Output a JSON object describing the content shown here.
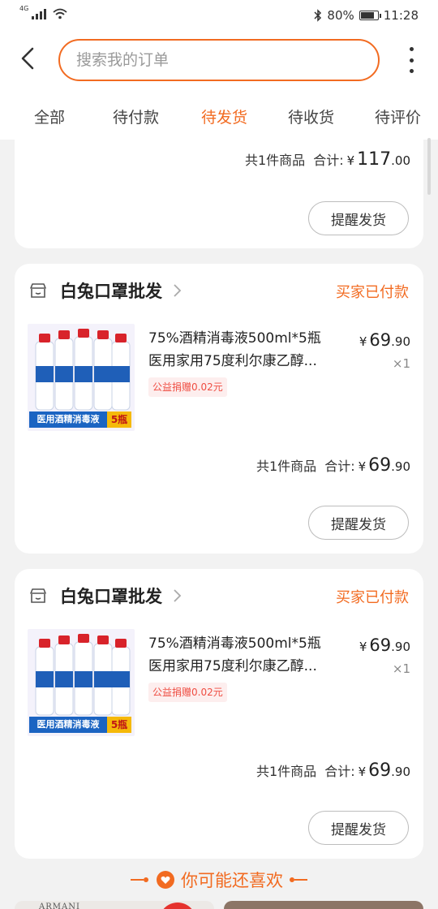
{
  "status_bar": {
    "network": "4G",
    "battery": "80%",
    "battery_level": 0.8,
    "time": "11:28"
  },
  "search": {
    "placeholder": "搜索我的订单"
  },
  "tabs": [
    {
      "label": "全部"
    },
    {
      "label": "待付款"
    },
    {
      "label": "待发货",
      "active": true
    },
    {
      "label": "待收货"
    },
    {
      "label": "待评价"
    }
  ],
  "orders": [
    {
      "total_count": "共1件商品",
      "total_label": "合计:",
      "currency": "¥",
      "total_int": "117",
      "total_dec": ".00",
      "action": "提醒发货"
    },
    {
      "shop": "白兔口罩批发",
      "status": "买家已付款",
      "product_line1": "75%酒精消毒液500ml*5瓶",
      "product_line2": "医用家用75度利尔康乙醇...",
      "charity": "公益捐赠0.02元",
      "currency": "¥",
      "price_int": "69",
      "price_dec": ".90",
      "qty": "×1",
      "thumb_strip": "医用酒精消毒液",
      "thumb_count": "5瓶",
      "total_count": "共1件商品",
      "total_label": "合计:",
      "total_int": "69",
      "total_dec": ".90",
      "action": "提醒发货"
    },
    {
      "shop": "白兔口罩批发",
      "status": "买家已付款",
      "product_line1": "75%酒精消毒液500ml*5瓶",
      "product_line2": "医用家用75度利尔康乙醇...",
      "charity": "公益捐赠0.02元",
      "currency": "¥",
      "price_int": "69",
      "price_dec": ".90",
      "qty": "×1",
      "thumb_strip": "医用酒精消毒液",
      "thumb_count": "5瓶",
      "total_count": "共1件商品",
      "total_label": "合计:",
      "total_int": "69",
      "total_dec": ".90",
      "action": "提醒发货"
    }
  ],
  "recommend": {
    "title": "你可能还喜欢",
    "brand_text": "ARMANI"
  },
  "colors": {
    "accent": "#f26b21",
    "charity_text": "#ef4d42",
    "charity_bg": "#fdeeee"
  }
}
